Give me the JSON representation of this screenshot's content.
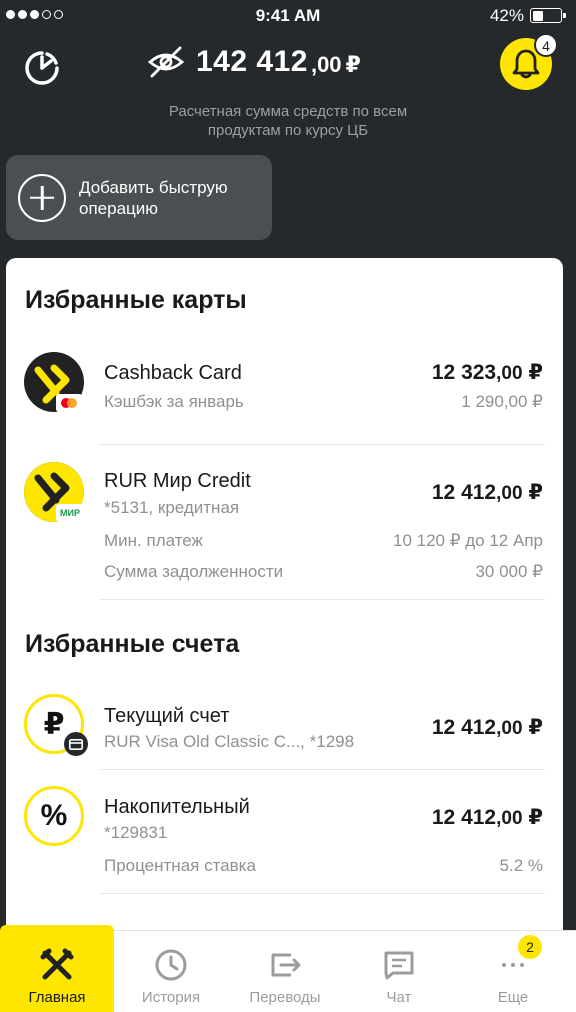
{
  "status_bar": {
    "time": "9:41 AM",
    "battery_percent": "42%",
    "battery_level": 0.42,
    "signal_bars_filled": 3,
    "signal_bars_total": 5
  },
  "header": {
    "balance_integer": "142 412",
    "balance_decimal": ",00",
    "balance_currency": "₽",
    "balance_note": "Расчетная сумма средств по всем продуктам по курсу ЦБ",
    "notifications_count": "4"
  },
  "quick_operation": {
    "label": "Добавить быструю операцию"
  },
  "favorite_cards": {
    "title": "Избранные карты",
    "items": [
      {
        "name": "Cashback Card",
        "subtitle": "Кэшбэк за январь",
        "amount_int": "12 323",
        "amount_dec": ",00",
        "currency": "₽",
        "secondary_amount": "1 290,00 ₽",
        "payment_system": "mastercard"
      },
      {
        "name": "RUR Мир Credit",
        "subtitle": "*5131,   кредитная",
        "amount_int": "12 412",
        "amount_dec": ",00",
        "currency": "₽",
        "payment_system_label": "МИР",
        "min_payment_label": "Мин. платеж",
        "min_payment_value": "10 120 ₽ до 12 Апр",
        "debt_label": "Сумма задолженности",
        "debt_value": "30 000 ₽"
      }
    ]
  },
  "favorite_accounts": {
    "title": "Избранные счета",
    "items": [
      {
        "name": "Текущий счет",
        "subtitle": "RUR Visa Old Classic C..., *1298",
        "amount_int": "12 412",
        "amount_dec": ",00",
        "currency": "₽",
        "avatar_symbol": "₽"
      },
      {
        "name": "Накопительный",
        "subtitle": "*129831",
        "amount_int": "12 412",
        "amount_dec": ",00",
        "currency": "₽",
        "avatar_symbol": "%",
        "rate_label": "Процентная ставка",
        "rate_value": "5.2 %"
      }
    ]
  },
  "tab_bar": {
    "tabs": [
      {
        "label": "Главная",
        "icon": "raiffeisen-logo-icon",
        "active": true
      },
      {
        "label": "История",
        "icon": "clock-icon"
      },
      {
        "label": "Переводы",
        "icon": "transfer-icon"
      },
      {
        "label": "Чат",
        "icon": "chat-icon"
      },
      {
        "label": "Еще",
        "icon": "more-icon",
        "badge": "2"
      }
    ]
  },
  "colors": {
    "brand_yellow": "#fee600",
    "header_bg": "#25292b",
    "quick_op_bg": "#4a4f52",
    "muted_text": "#8e9194"
  }
}
